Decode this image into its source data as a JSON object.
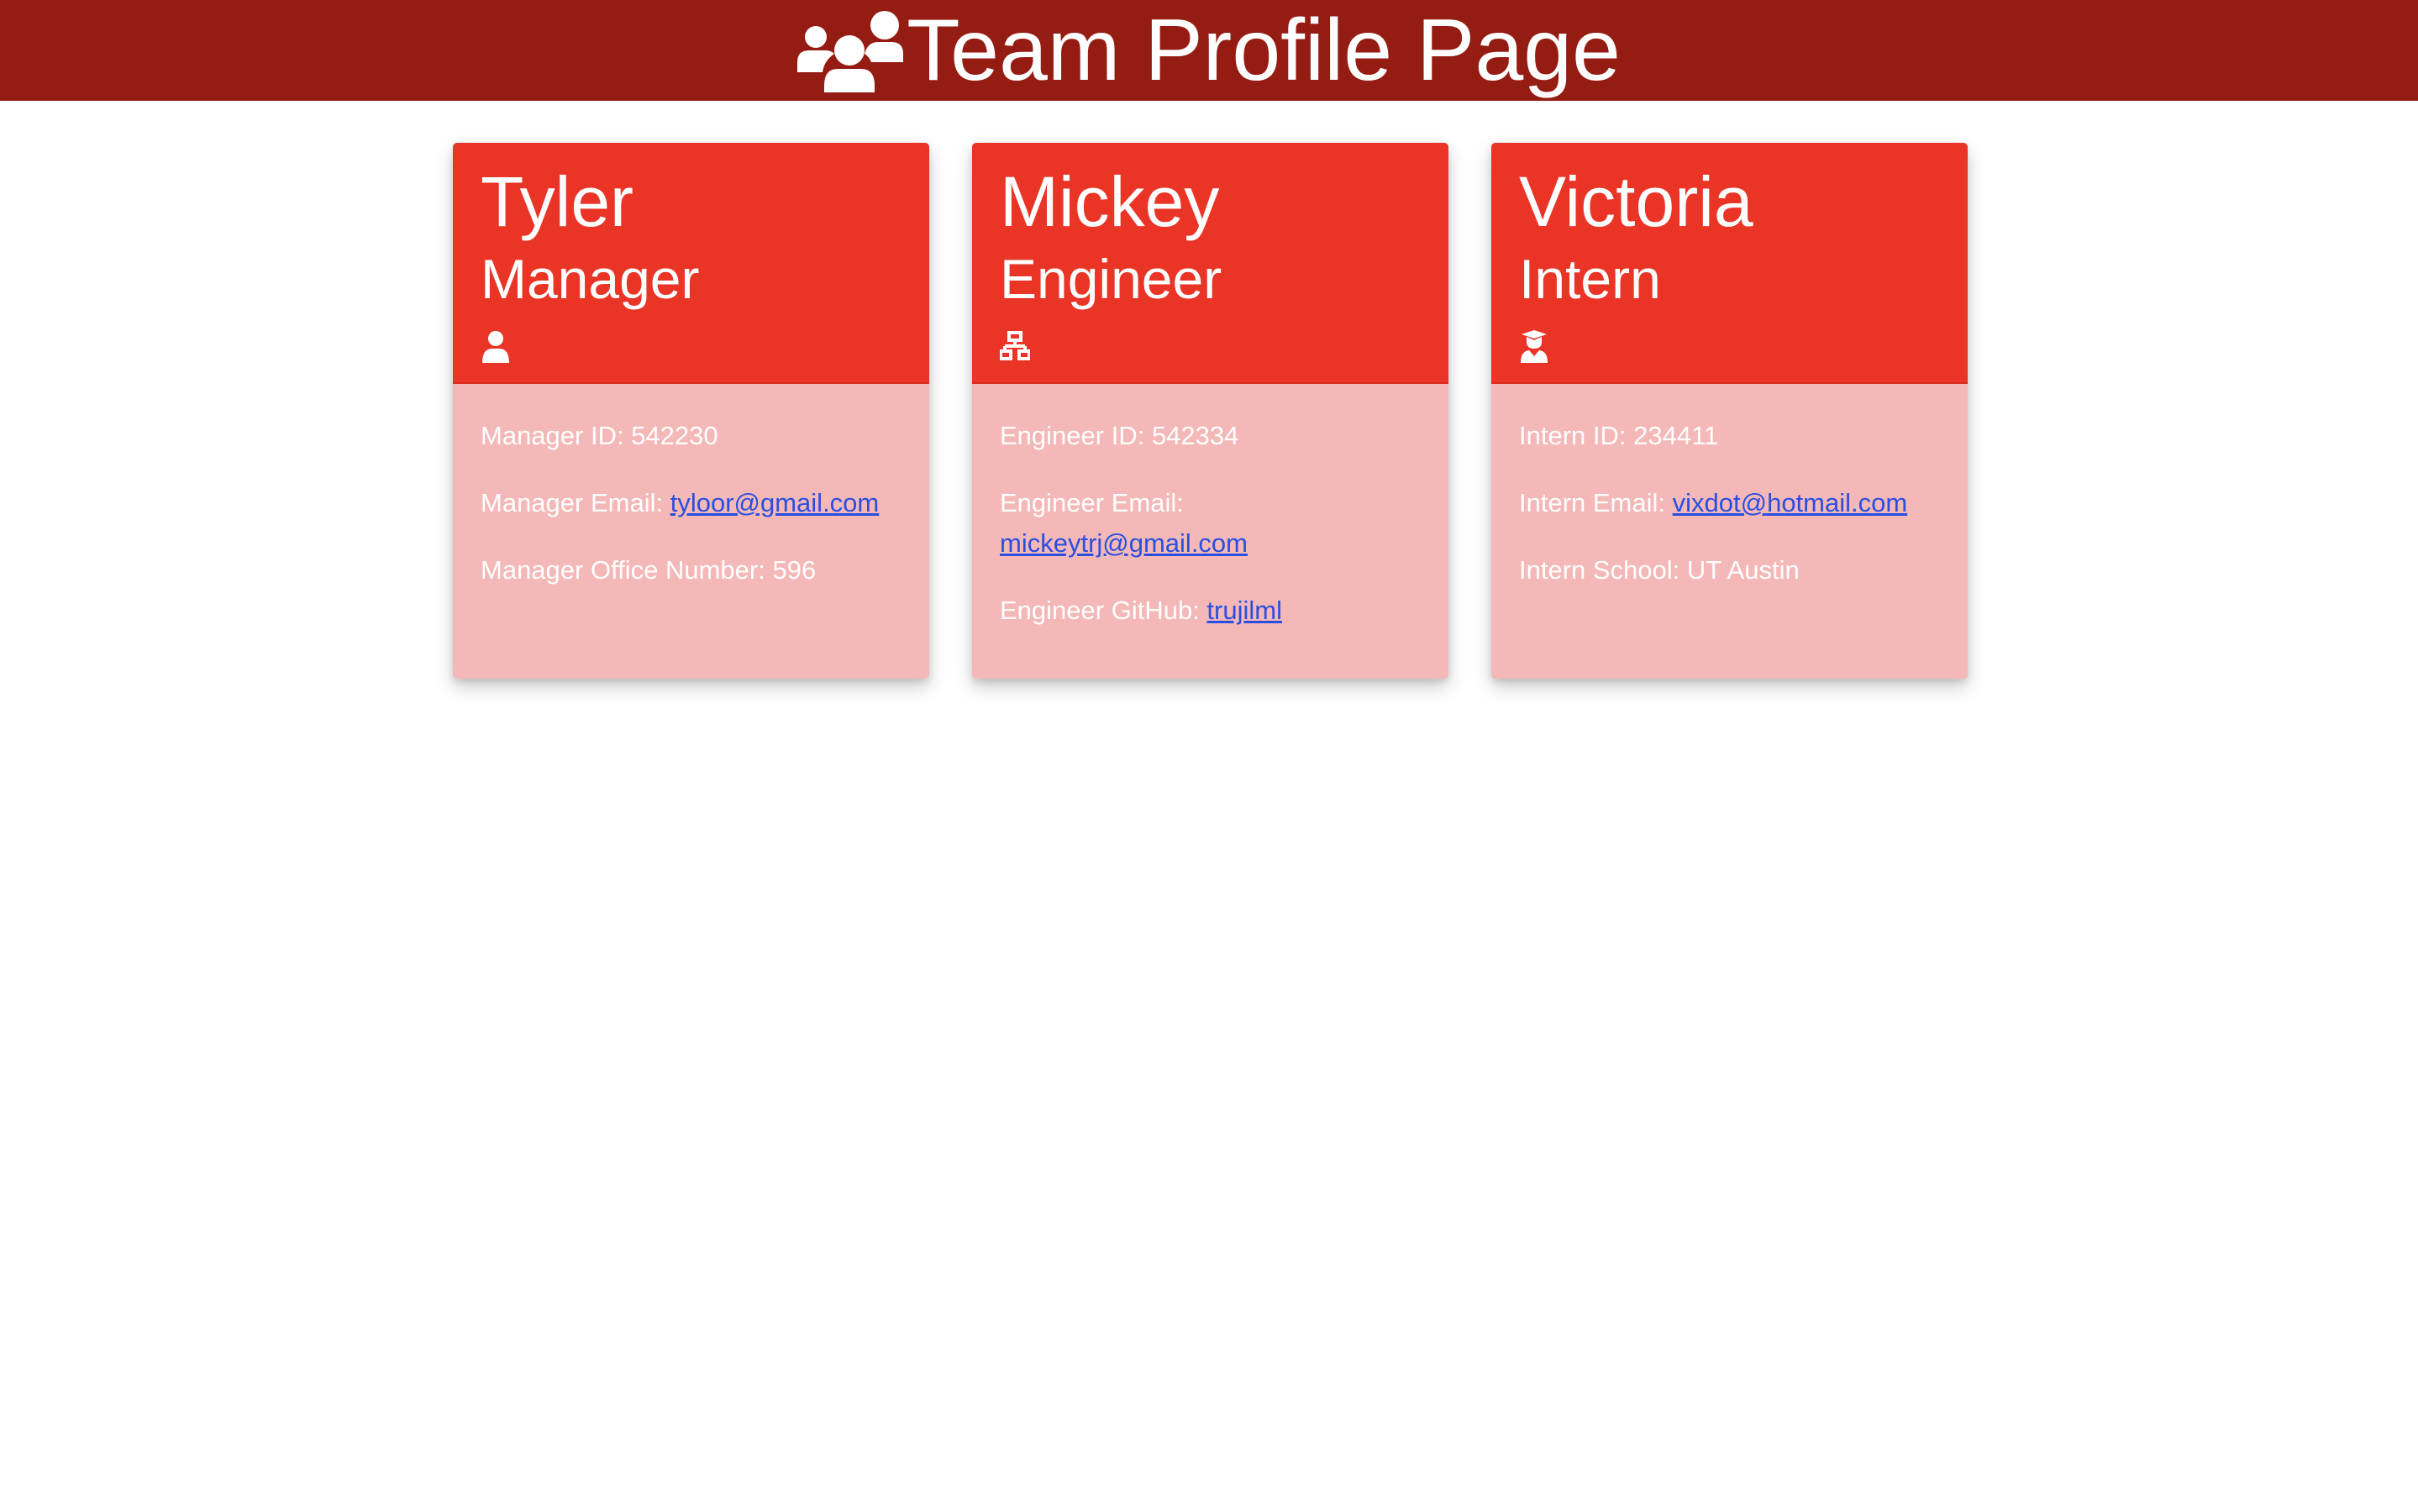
{
  "header": {
    "title": "Team Profile Page",
    "icon": "users-icon"
  },
  "colors": {
    "banner": "#951c13",
    "card_header": "#ea3426",
    "card_body": "#f3b8b7",
    "link": "#2a4fe0",
    "text": "#ffffff"
  },
  "team": [
    {
      "name": "Tyler",
      "role": "Manager",
      "icon": "user-icon",
      "fields": [
        {
          "label": "Manager ID: ",
          "value": "542230",
          "link": false
        },
        {
          "label": "Manager Email: ",
          "value": "tyloor@gmail.com",
          "link": true
        },
        {
          "label": "Manager Office Number: ",
          "value": "596",
          "link": false
        }
      ]
    },
    {
      "name": "Mickey",
      "role": "Engineer",
      "icon": "sitemap-icon",
      "fields": [
        {
          "label": "Engineer ID: ",
          "value": "542334",
          "link": false
        },
        {
          "label": "Engineer Email: ",
          "value": "mickeytrj@gmail.com",
          "link": true
        },
        {
          "label": "Engineer GitHub: ",
          "value": "trujilml",
          "link": true
        }
      ]
    },
    {
      "name": "Victoria",
      "role": "Intern",
      "icon": "graduate-icon",
      "fields": [
        {
          "label": "Intern ID: ",
          "value": "234411",
          "link": false
        },
        {
          "label": "Intern Email: ",
          "value": "vixdot@hotmail.com",
          "link": true
        },
        {
          "label": "Intern School: ",
          "value": "UT Austin",
          "link": false
        }
      ]
    }
  ]
}
